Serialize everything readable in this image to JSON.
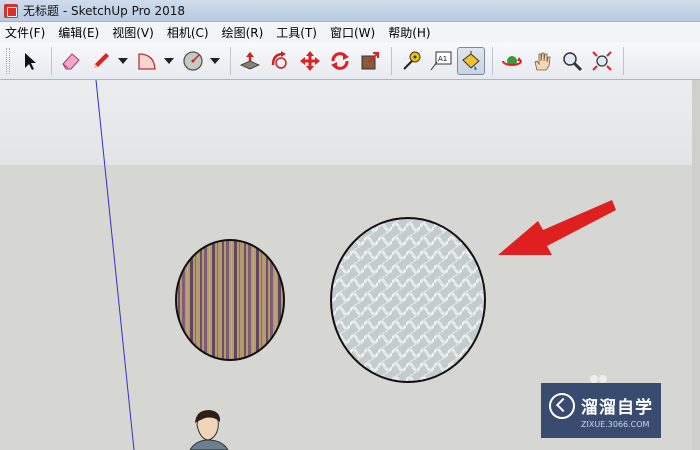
{
  "window": {
    "title": "无标题 - SketchUp Pro 2018"
  },
  "menu": {
    "items": [
      {
        "label": "文件(F)"
      },
      {
        "label": "编辑(E)"
      },
      {
        "label": "视图(V)"
      },
      {
        "label": "相机(C)"
      },
      {
        "label": "绘图(R)"
      },
      {
        "label": "工具(T)"
      },
      {
        "label": "窗口(W)"
      },
      {
        "label": "帮助(H)"
      }
    ]
  },
  "toolbar": {
    "tools": [
      "select-tool",
      "eraser-tool",
      "pencil-tool",
      "arc-tool",
      "circle-tool",
      "push-pull-tool",
      "follow-me-tool",
      "move-tool",
      "rotate-tool",
      "scale-tool",
      "tape-measure-tool",
      "text-tool",
      "paint-bucket-tool",
      "orbit-tool",
      "pan-tool",
      "zoom-tool",
      "zoom-extents-tool"
    ],
    "active_tool": "paint-bucket-tool",
    "text_tool_label": "A1"
  },
  "scene": {
    "left_ellipse_material": "striped fabric",
    "right_ellipse_material": "white knit texture",
    "arrow_color": "#e02020",
    "edge_color": "#111111"
  },
  "watermark": {
    "title": "溜溜自学",
    "subtitle": "ZIXUE.3066.COM"
  }
}
